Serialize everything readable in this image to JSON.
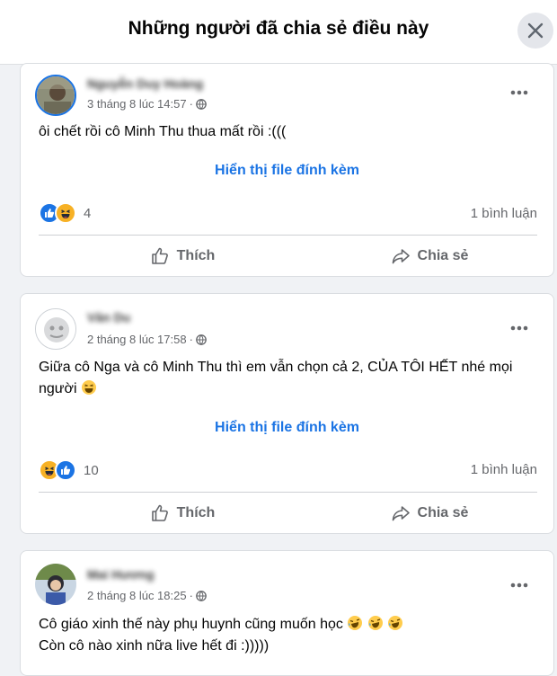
{
  "dialog": {
    "title": "Những người đã chia sẻ điều này",
    "close_icon": "close-icon"
  },
  "posts": [
    {
      "author": "Nguyễn Duy Hoàng",
      "timestamp": "3 tháng 8 lúc 14:57",
      "separator": "·",
      "text": "ôi chết rồi cô Minh Thu thua mất rồi :(((",
      "attachment_label": "Hiển thị file đính kèm",
      "reactions": [
        "like",
        "haha"
      ],
      "reaction_count": "4",
      "comment_count": "1 bình luận",
      "like_label": "Thích",
      "share_label": "Chia sẻ"
    },
    {
      "author": "Vân Du",
      "timestamp": "2 tháng 8 lúc 17:58",
      "separator": "·",
      "text": "Giữa cô Nga và cô Minh Thu thì em vẫn chọn cả 2, CỦA TÔI HẾT nhé mọi người",
      "attachment_label": "Hiển thị file đính kèm",
      "reactions": [
        "haha",
        "like"
      ],
      "reaction_count": "10",
      "comment_count": "1 bình luận",
      "like_label": "Thích",
      "share_label": "Chia sẻ"
    },
    {
      "author": "Mai Hương",
      "timestamp": "2 tháng 8 lúc 18:25",
      "separator": "·",
      "text_line1": "Cô giáo xinh thế này phụ huynh cũng muốn học",
      "text_line2": "Còn cô nào xinh nữa live hết đi :)))))"
    }
  ],
  "colors": {
    "accent": "#1b74e4",
    "secondary_text": "#65676b",
    "background": "#f0f2f5"
  }
}
